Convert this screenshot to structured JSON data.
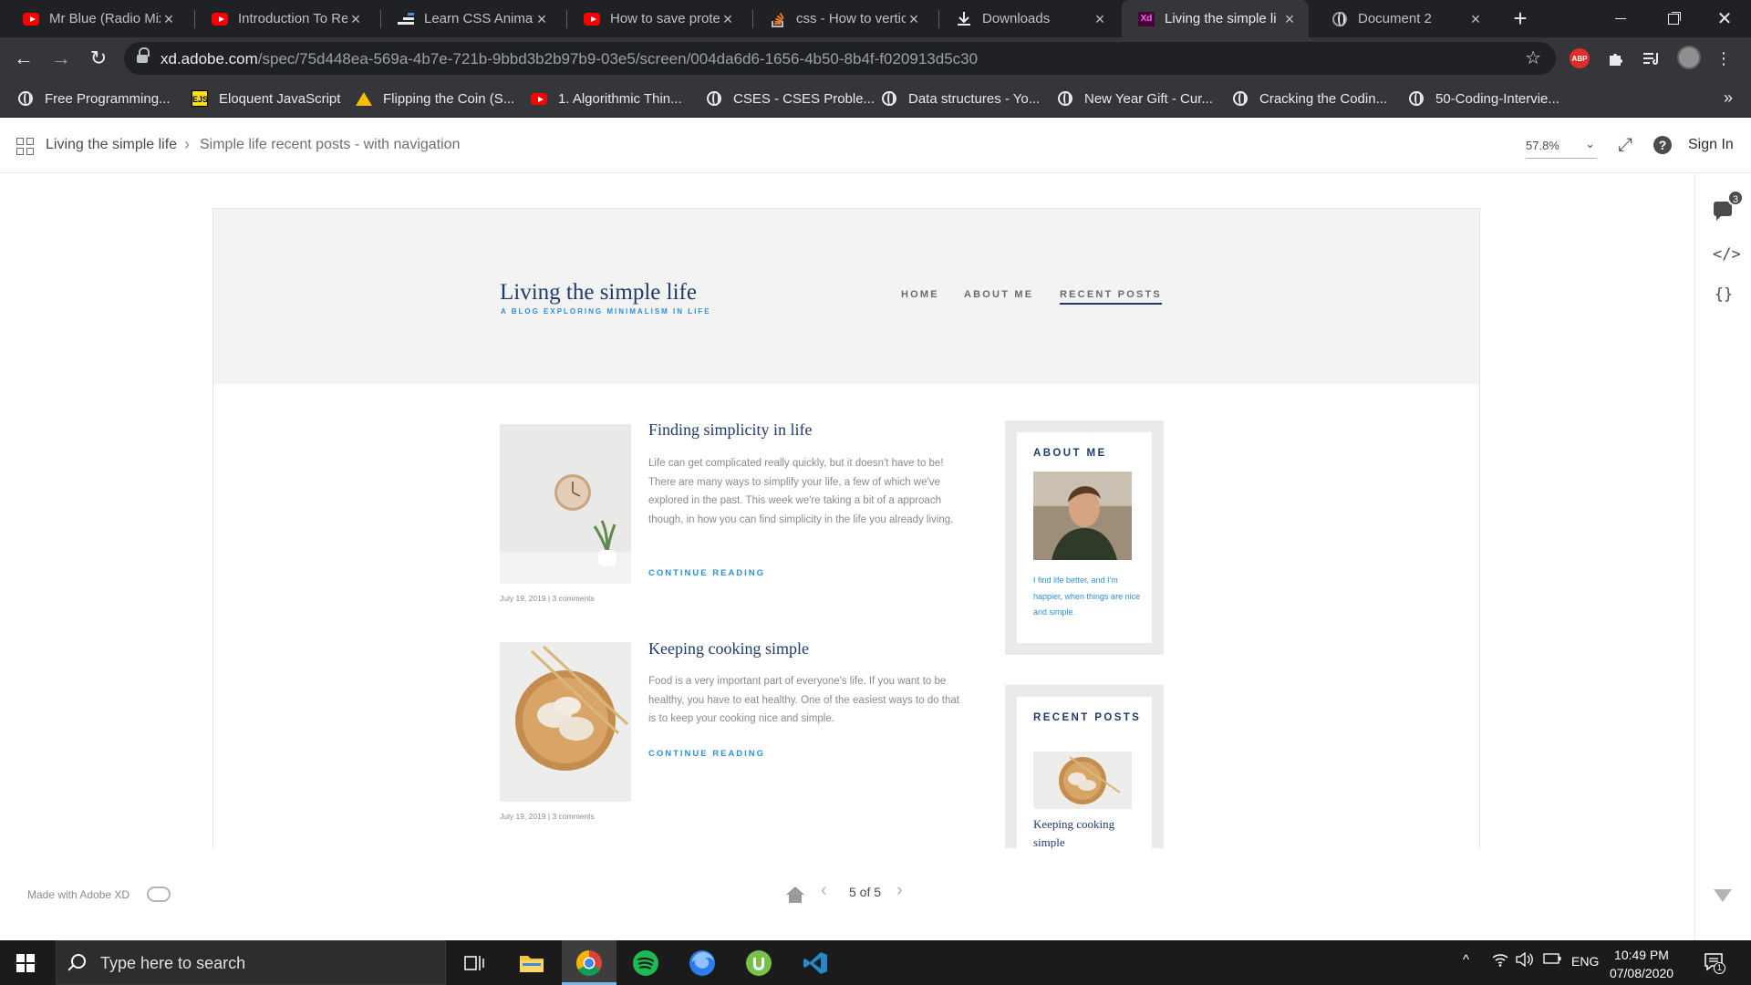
{
  "browser": {
    "tabs": [
      {
        "label": "Mr Blue (Radio Mix",
        "icon": "youtube-icon"
      },
      {
        "label": "Introduction To Re",
        "icon": "youtube-icon"
      },
      {
        "label": "Learn CSS Animati",
        "icon": "css-tricks-icon"
      },
      {
        "label": "How to save prote",
        "icon": "youtube-icon"
      },
      {
        "label": "css - How to vertic",
        "icon": "stackoverflow-icon"
      },
      {
        "label": "Downloads",
        "icon": "download-icon"
      },
      {
        "label": "Living the simple li",
        "icon": "adobe-xd-icon",
        "active": true
      },
      {
        "label": "Document 2",
        "icon": "globe-icon"
      }
    ],
    "url_host": "xd.adobe.com",
    "url_path": "/spec/75d448ea-569a-4b7e-721b-9bbd3b2b97b9-03e5/screen/004da6d6-1656-4b50-8b4f-f020913d5c30",
    "bookmarks": [
      {
        "label": "Free Programming...",
        "icon": "globe-icon"
      },
      {
        "label": "Eloquent JavaScript",
        "icon": "ejs-icon"
      },
      {
        "label": "Flipping the Coin (S...",
        "icon": "google-drive-icon"
      },
      {
        "label": "1. Algorithmic Thin...",
        "icon": "youtube-icon"
      },
      {
        "label": "CSES - CSES Proble...",
        "icon": "globe-icon"
      },
      {
        "label": "Data structures - Yo...",
        "icon": "globe-icon"
      },
      {
        "label": "New Year Gift - Cur...",
        "icon": "globe-icon"
      },
      {
        "label": "Cracking the Codin...",
        "icon": "globe-icon"
      },
      {
        "label": "50-Coding-Intervie...",
        "icon": "globe-icon"
      }
    ],
    "extension_abp": "ABP",
    "bookmarks_overflow": "»"
  },
  "xd": {
    "breadcrumb_project": "Living the simple life",
    "breadcrumb_sep": "›",
    "breadcrumb_screen": "Simple life recent posts - with navigation",
    "zoom": "57.8%",
    "help_label": "?",
    "sign_in": "Sign In",
    "comment_count": "3",
    "code_icon_label": "</>",
    "braces_icon_label": "{}",
    "made_with": "Made with Adobe XD",
    "pager_text": "5 of 5",
    "prev": "‹",
    "next": "›"
  },
  "site": {
    "title": "Living the simple life",
    "tagline": "A BLOG EXPLORING MINIMALISM IN LIFE",
    "nav": [
      "HOME",
      "ABOUT ME",
      "RECENT POSTS"
    ],
    "posts": [
      {
        "title": "Finding simplicity in life",
        "excerpt": "Life can get complicated really quickly, but it doesn't have to be! There are many ways to simplify your life, a few of which we've explored in the past. This week we're taking a bit of a approach though, in how you can find simplicity in the life you already living.",
        "cta": "CONTINUE READING",
        "meta": "July 19, 2019  |  3 comments"
      },
      {
        "title": "Keeping cooking simple",
        "excerpt": "Food is a very important part of everyone's life. If you want to be healthy, you have to eat healthy. One of the easiest ways to do that is to keep your cooking nice and simple.",
        "cta": "CONTINUE READING",
        "meta": "July 19, 2019  |  3 comments"
      }
    ],
    "about": {
      "title": "ABOUT ME",
      "text": "I find life better, and I'm happier, when things are nice and simple."
    },
    "recent": {
      "title": "RECENT POSTS",
      "post_link": "Keeping cooking simple"
    }
  },
  "taskbar": {
    "search_placeholder": "Type here to search",
    "lang": "ENG",
    "time": "10:49 PM",
    "date": "07/08/2020",
    "notification_count": "1"
  },
  "colors": {
    "chrome_dark": "#202124",
    "chrome_toolbar": "#35363a",
    "site_navy": "#203a6c",
    "site_blue": "#2d8fd4",
    "hero_gray": "#f3f3f3"
  }
}
